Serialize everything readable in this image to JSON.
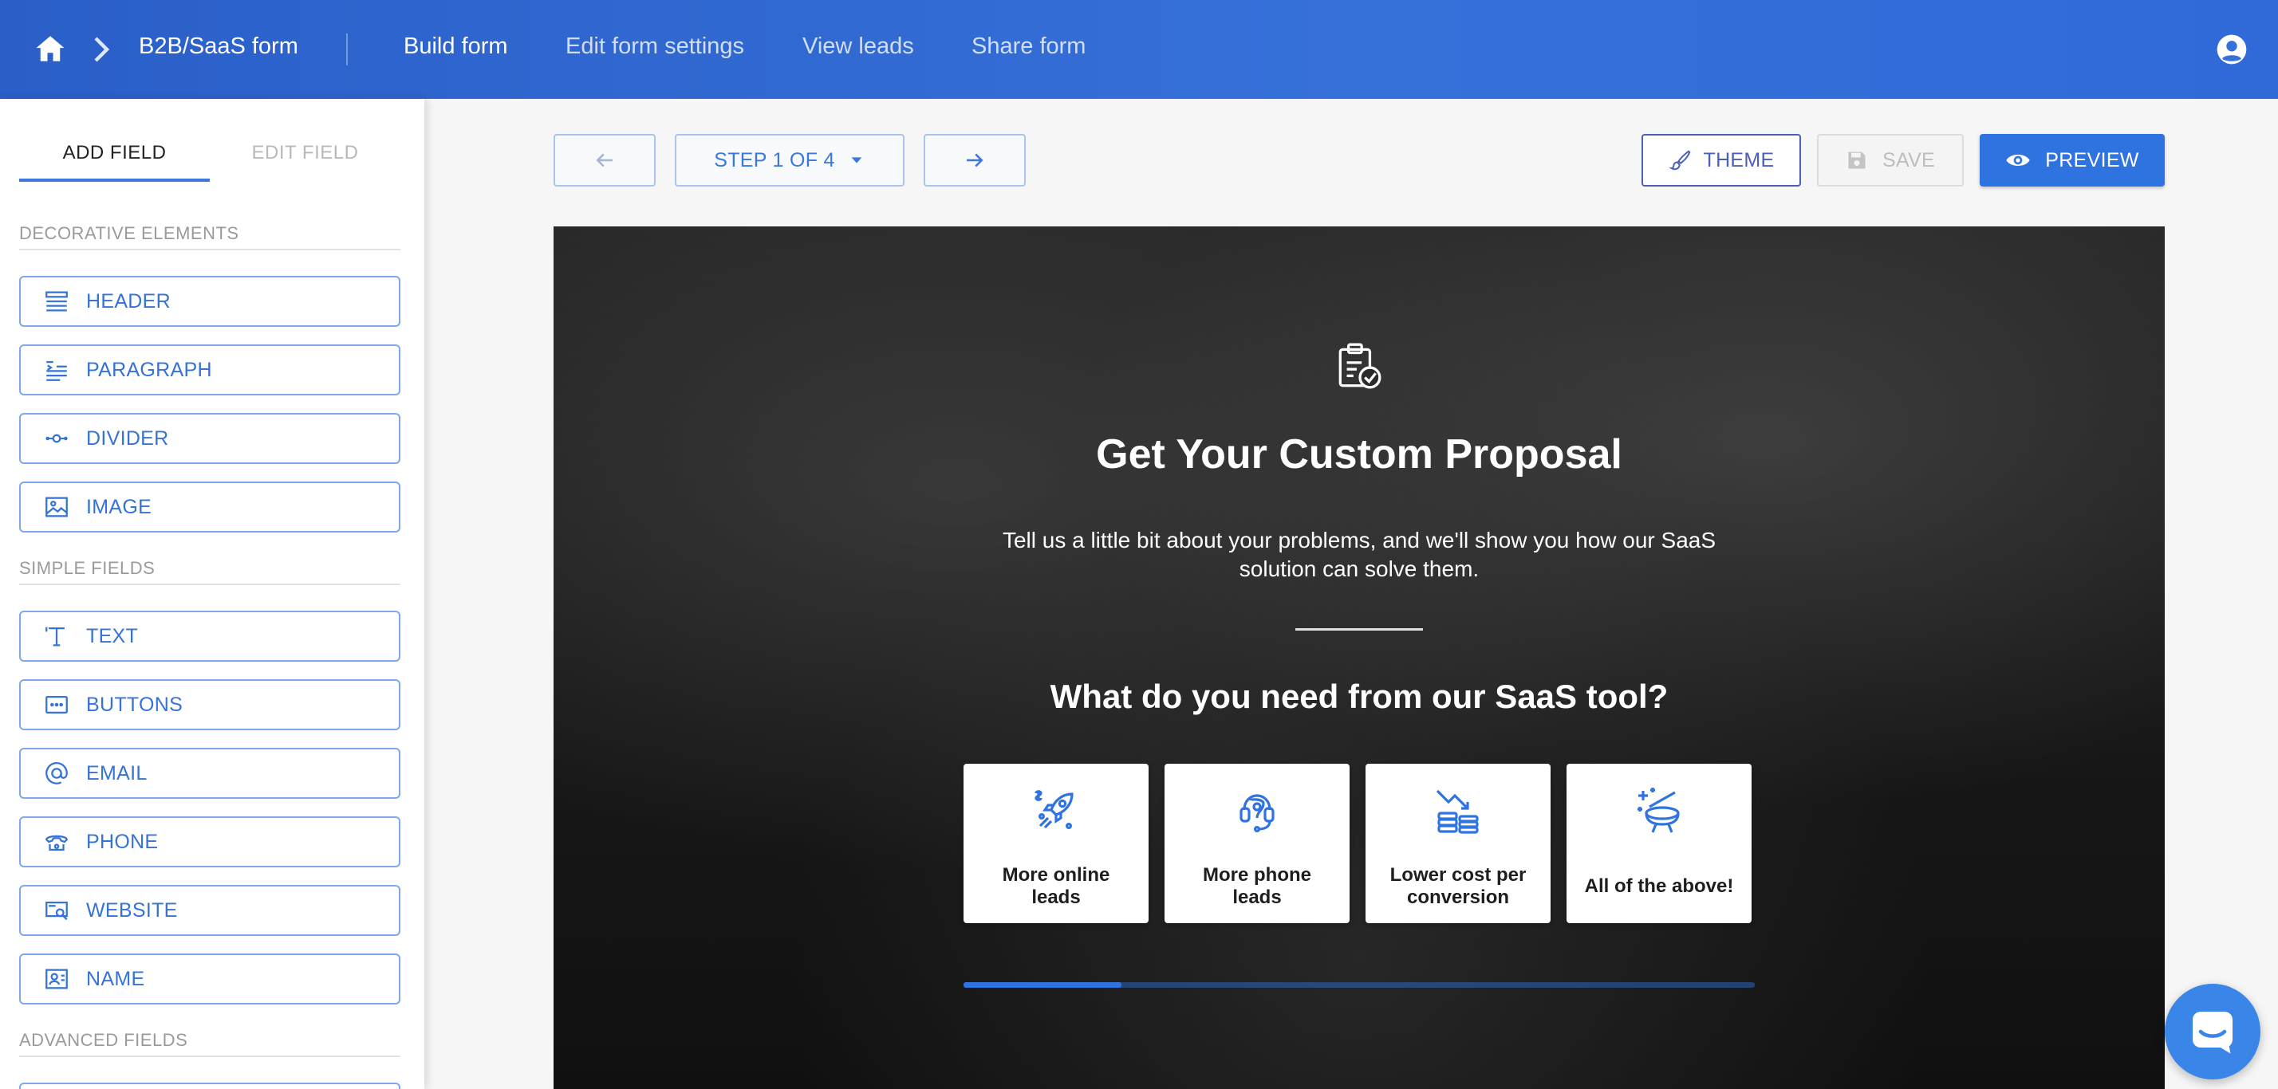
{
  "topbar": {
    "breadcrumb": "B2B/SaaS form",
    "nav": [
      "Build form",
      "Edit form settings",
      "View leads",
      "Share form"
    ]
  },
  "sidebar": {
    "tabs": {
      "add": "ADD FIELD",
      "edit": "EDIT FIELD"
    },
    "sections": {
      "decorative": "DECORATIVE ELEMENTS",
      "simple": "SIMPLE FIELDS",
      "advanced": "ADVANCED FIELDS"
    },
    "decorative_items": [
      {
        "label": "HEADER",
        "icon": "header-icon"
      },
      {
        "label": "PARAGRAPH",
        "icon": "paragraph-icon"
      },
      {
        "label": "DIVIDER",
        "icon": "divider-icon"
      },
      {
        "label": "IMAGE",
        "icon": "image-icon"
      }
    ],
    "simple_items": [
      {
        "label": "TEXT",
        "icon": "text-icon"
      },
      {
        "label": "BUTTONS",
        "icon": "buttons-icon"
      },
      {
        "label": "EMAIL",
        "icon": "at-icon"
      },
      {
        "label": "PHONE",
        "icon": "phone-icon"
      },
      {
        "label": "WEBSITE",
        "icon": "website-icon"
      },
      {
        "label": "NAME",
        "icon": "name-icon"
      }
    ]
  },
  "toolbar": {
    "step": "STEP 1 OF 4",
    "theme": "THEME",
    "save": "SAVE",
    "preview": "PREVIEW"
  },
  "form": {
    "title": "Get Your Custom Proposal",
    "description": "Tell us a little bit about your problems, and we'll show you how our SaaS solution can solve them.",
    "question": "What do you need from our SaaS tool?",
    "choices": [
      {
        "label_line1": "More online",
        "label_line2": "leads",
        "icon": "rocket-icon"
      },
      {
        "label_line1": "More phone",
        "label_line2": "leads",
        "icon": "headset-icon"
      },
      {
        "label_line1": "Lower cost per",
        "label_line2": "conversion",
        "icon": "coins-down-icon"
      },
      {
        "label_line1": "All of the above!",
        "label_line2": "",
        "icon": "magic-icon"
      }
    ],
    "progress": 0.2
  },
  "colors": {
    "brand": "#2f73e0",
    "topbar": "#3670d9",
    "field_border": "#7ea8ea",
    "theme_accent": "#4b5fb8"
  }
}
